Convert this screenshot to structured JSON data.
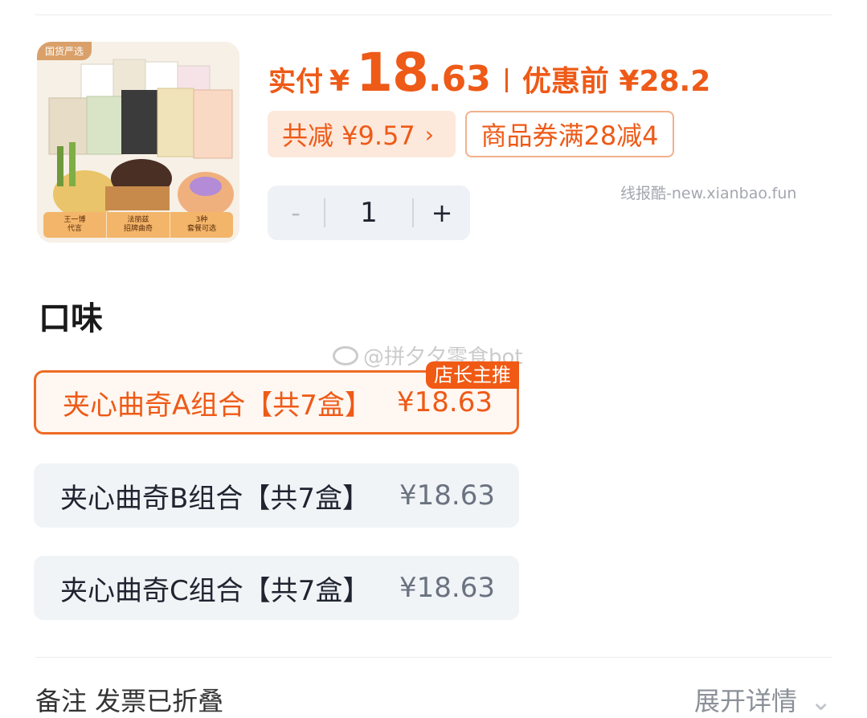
{
  "product": {
    "tag": "国货严选",
    "banner": [
      "王一博\n代言",
      "法丽兹\n招牌曲奇",
      "3种\n套餐可选"
    ]
  },
  "price": {
    "paid_label": "实付",
    "currency": "¥",
    "paid_int": "18",
    "paid_dot": ".",
    "paid_dec": "63",
    "before_label": "优惠前 ¥28.2"
  },
  "discount": {
    "total_reduce": "共减 ¥9.57",
    "chevron": "›",
    "coupon": "商品券满28减4"
  },
  "site_watermark": "线报酷-new.xianbao.fun",
  "stepper": {
    "minus": "-",
    "qty": "1",
    "plus": "+"
  },
  "flavor": {
    "title": "口味",
    "options": [
      {
        "name": "夹心曲奇A组合【共7盒】",
        "price": "¥18.63",
        "selected": true,
        "badge": "店长主推"
      },
      {
        "name": "夹心曲奇B组合【共7盒】",
        "price": "¥18.63",
        "selected": false
      },
      {
        "name": "夹心曲奇C组合【共7盒】",
        "price": "¥18.63",
        "selected": false
      }
    ]
  },
  "weibo_watermark": "@拼夕夕零食bot",
  "footer": {
    "left": "备注 发票已折叠",
    "right": "展开详情"
  },
  "colors": {
    "accent": "#ee5a17",
    "option_bg": "#f1f4f7"
  }
}
